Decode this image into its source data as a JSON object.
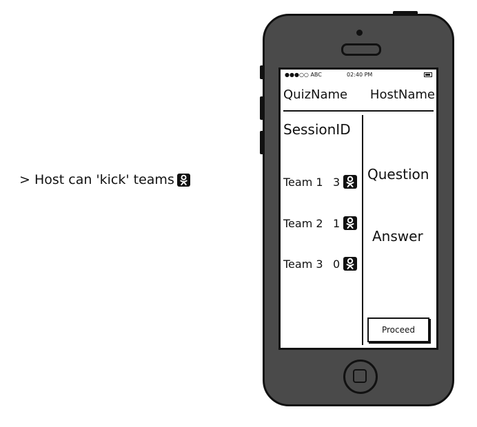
{
  "annotation": {
    "text": "> Host can 'kick' teams"
  },
  "statusbar": {
    "carrier": "●●●○○ ABC",
    "time": "02:40 PM"
  },
  "header": {
    "quiz_name": "QuizName",
    "host_name": "HostName"
  },
  "session": {
    "id_label": "SessionID"
  },
  "teams": [
    {
      "name": "Team 1",
      "score": "3"
    },
    {
      "name": "Team 2",
      "score": "1"
    },
    {
      "name": "Team 3",
      "score": "0"
    }
  ],
  "main": {
    "question": "Question",
    "answer": "Answer",
    "proceed_label": "Proceed"
  },
  "icons": {
    "kick": "odnoklassniki-person-icon"
  }
}
